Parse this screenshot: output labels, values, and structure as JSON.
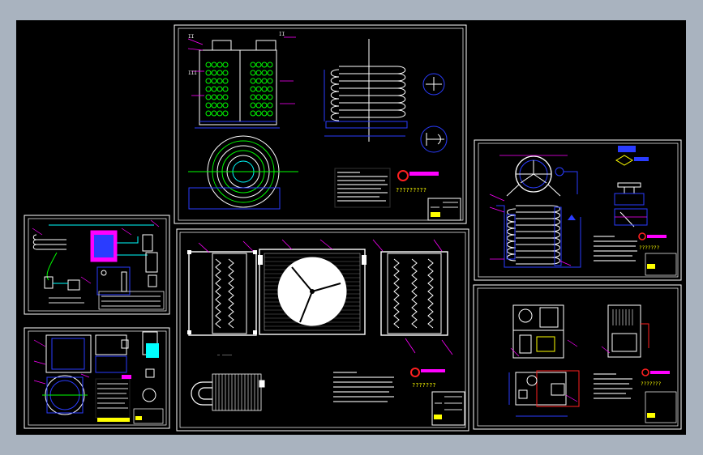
{
  "canvas": {
    "background": "#a9b3bf",
    "paper": "#000000"
  },
  "colors": {
    "frame": "#ffffff",
    "cyan": "#00ffff",
    "blue": "#2a3cff",
    "green": "#00ff00",
    "yellow": "#ffff00",
    "magenta": "#ff00ff",
    "red": "#ff2020",
    "white": "#ffffff"
  },
  "labels": {
    "tag_ii": "II",
    "tag_iii": "III",
    "caret_marks": "???????",
    "caret_marks_long": "?????????"
  }
}
